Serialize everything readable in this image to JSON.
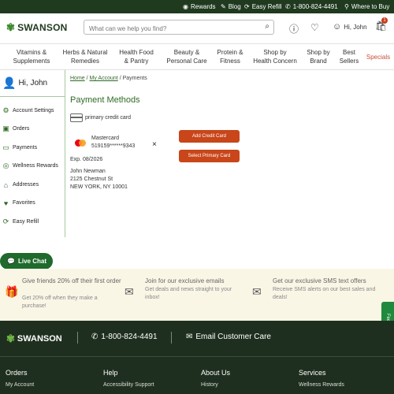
{
  "topbar": {
    "rewards": "Rewards",
    "blog": "Blog",
    "easy_refill": "Easy Refill",
    "phone": "1-800-824-4491",
    "where_to_buy": "Where to Buy"
  },
  "header": {
    "logo": "SWANSON",
    "search_placeholder": "What can we help you find?",
    "greeting": "Hi, John",
    "cart_count": "1"
  },
  "nav": [
    {
      "line1": "Vitamins &",
      "line2": "Supplements"
    },
    {
      "line1": "Herbs & Natural",
      "line2": "Remedies"
    },
    {
      "line1": "Health Food",
      "line2": "& Pantry"
    },
    {
      "line1": "Beauty &",
      "line2": "Personal Care"
    },
    {
      "line1": "Protein &",
      "line2": "Fitness"
    },
    {
      "line1": "Shop by",
      "line2": "Health Concern"
    },
    {
      "line1": "Shop by",
      "line2": "Brand"
    },
    {
      "line1": "Best",
      "line2": "Sellers"
    },
    {
      "line1": "Specials",
      "line2": ""
    }
  ],
  "sidebar": {
    "greeting": "Hi, John",
    "items": [
      {
        "label": "Account Settings",
        "icon": "settings-icon"
      },
      {
        "label": "Orders",
        "icon": "box-icon"
      },
      {
        "label": "Payments",
        "icon": "card-icon"
      },
      {
        "label": "Wellness Rewards",
        "icon": "rewards-icon"
      },
      {
        "label": "Addresses",
        "icon": "home-icon"
      },
      {
        "label": "Favorites",
        "icon": "heart-icon"
      },
      {
        "label": "Easy Refill",
        "icon": "refill-icon"
      }
    ]
  },
  "breadcrumb": {
    "home": "Home",
    "sep1": "/",
    "account": "My Account",
    "sep2": "/",
    "current": "Payments"
  },
  "main": {
    "title": "Payment Methods",
    "primary_label": "primary credit card",
    "card_brand": "Mastercard",
    "card_number": "519159******9343",
    "remove": "×",
    "add_button": "Add Credit Card",
    "select_button": "Select Primary Card",
    "expiry": "Exp. 08/2026",
    "address_name": "John Newman",
    "address_street": "2125 Chestnut St",
    "address_city": "NEW YORK, NY 10001"
  },
  "live_chat": "Live Chat",
  "promo": [
    {
      "heading": "Give friends 20% off their first order",
      "text": "Get 20% off when they make a purchase!",
      "icon": "gift-icon"
    },
    {
      "heading": "Join for our exclusive emails",
      "text": "Get deals and news straight to your inbox!",
      "icon": "envelope-icon"
    },
    {
      "heading": "Get our exclusive SMS text offers",
      "text": "Receive SMS alerts on our best sales and deals!",
      "icon": "sms-icon"
    }
  ],
  "feedback": "Feedback",
  "footer": {
    "logo": "SWANSON",
    "phone": "1-800-824-4491",
    "email": "Email Customer Care",
    "columns": [
      {
        "heading": "Orders",
        "link1": "My Account"
      },
      {
        "heading": "Help",
        "link1": "Accessibility Support"
      },
      {
        "heading": "About Us",
        "link1": "History"
      },
      {
        "heading": "Services",
        "link1": "Wellness Rewards"
      }
    ]
  },
  "colors": {
    "brand_green": "#2f6b25",
    "dark_green": "#1f3a1f",
    "button_orange": "#c8461a",
    "specials_red": "#c8503a"
  }
}
